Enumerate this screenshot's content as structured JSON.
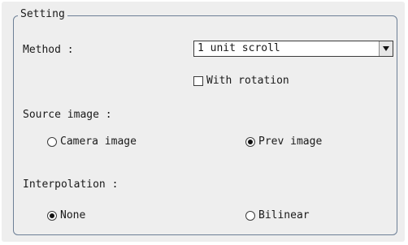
{
  "group": {
    "legend": "Setting"
  },
  "method": {
    "label": "Method :",
    "selected": "1 unit scroll",
    "icon": "chevron-down-icon"
  },
  "with_rotation": {
    "label": "With rotation",
    "checked": false
  },
  "source_image": {
    "label": "Source image :",
    "options": [
      {
        "label": "Camera image",
        "selected": false
      },
      {
        "label": "Prev image",
        "selected": true
      }
    ]
  },
  "interpolation": {
    "label": "Interpolation :",
    "options": [
      {
        "label": "None",
        "selected": true
      },
      {
        "label": "Bilinear",
        "selected": false
      }
    ]
  }
}
